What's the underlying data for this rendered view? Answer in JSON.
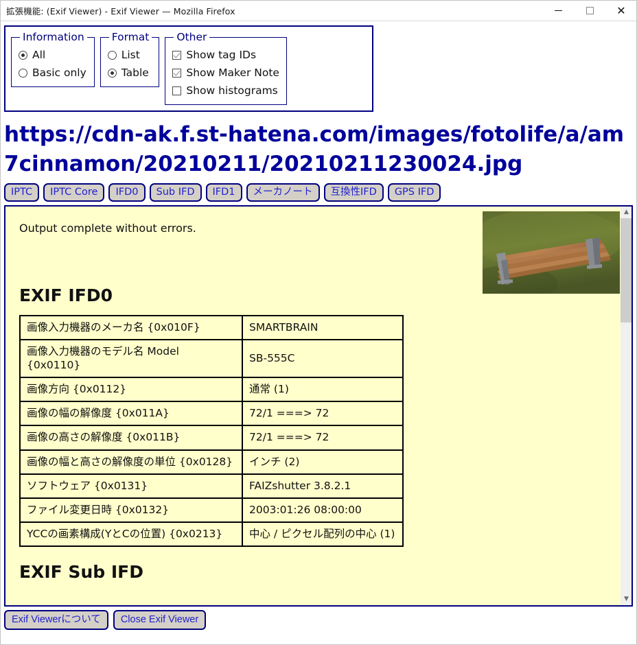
{
  "window": {
    "title": "拡張機能: (Exif Viewer) - Exif Viewer — Mozilla Firefox",
    "minimize_label": "Minimize",
    "maximize_label": "Maximize",
    "close_label": "Close"
  },
  "options": {
    "information": {
      "legend": "Information",
      "items": [
        {
          "label": "All",
          "selected": true
        },
        {
          "label": "Basic only",
          "selected": false
        }
      ]
    },
    "format": {
      "legend": "Format",
      "items": [
        {
          "label": "List",
          "selected": false
        },
        {
          "label": "Table",
          "selected": true
        }
      ]
    },
    "other": {
      "legend": "Other",
      "items": [
        {
          "label": "Show tag IDs",
          "checked": true
        },
        {
          "label": "Show Maker Note",
          "checked": true
        },
        {
          "label": "Show histograms",
          "checked": false
        }
      ]
    }
  },
  "url_heading": "https://cdn-ak.f.st-hatena.com/images/fotolife/a/am7cinnamon/20210211/20210211230024.jpg",
  "tabs": [
    {
      "label": "IPTC"
    },
    {
      "label": "IPTC Core"
    },
    {
      "label": "IFD0"
    },
    {
      "label": "Sub IFD"
    },
    {
      "label": "IFD1"
    },
    {
      "label": "メーカノート"
    },
    {
      "label": "互換性IFD"
    },
    {
      "label": "GPS IFD"
    }
  ],
  "output": {
    "status": "Output complete without errors.",
    "thumbnail_alt": "park bench photo thumbnail",
    "section_title": "EXIF IFD0",
    "section_title_2": "EXIF Sub IFD",
    "rows": [
      {
        "key": "画像入力機器のメーカ名 {0x010F}",
        "value": "SMARTBRAIN"
      },
      {
        "key": "画像入力機器のモデル名 Model {0x0110}",
        "value": "SB-555C"
      },
      {
        "key": "画像方向 {0x0112}",
        "value": "通常 (1)"
      },
      {
        "key": "画像の幅の解像度 {0x011A}",
        "value": "72/1 ===> 72"
      },
      {
        "key": "画像の高さの解像度 {0x011B}",
        "value": "72/1 ===> 72"
      },
      {
        "key": "画像の幅と高さの解像度の単位 {0x0128}",
        "value": "インチ (2)"
      },
      {
        "key": "ソフトウェア {0x0131}",
        "value": "FAIZshutter 3.8.2.1"
      },
      {
        "key": "ファイル変更日時 {0x0132}",
        "value": "2003:01:26 08:00:00"
      },
      {
        "key": "YCCの画素構成(YとCの位置) {0x0213}",
        "value": "中心 / ピクセル配列の中心 (1)"
      }
    ]
  },
  "footer": {
    "about_label": "Exif Viewerについて",
    "close_label": "Close Exif Viewer"
  },
  "scrollbar": {
    "up_glyph": "︿",
    "down_glyph": "﹀"
  },
  "colors": {
    "accent_navy": "#00007e",
    "link_blue": "#2020cc",
    "heading_blue": "#00009b",
    "panel_bg": "#ffffcc",
    "button_face": "#d4d0c8"
  }
}
